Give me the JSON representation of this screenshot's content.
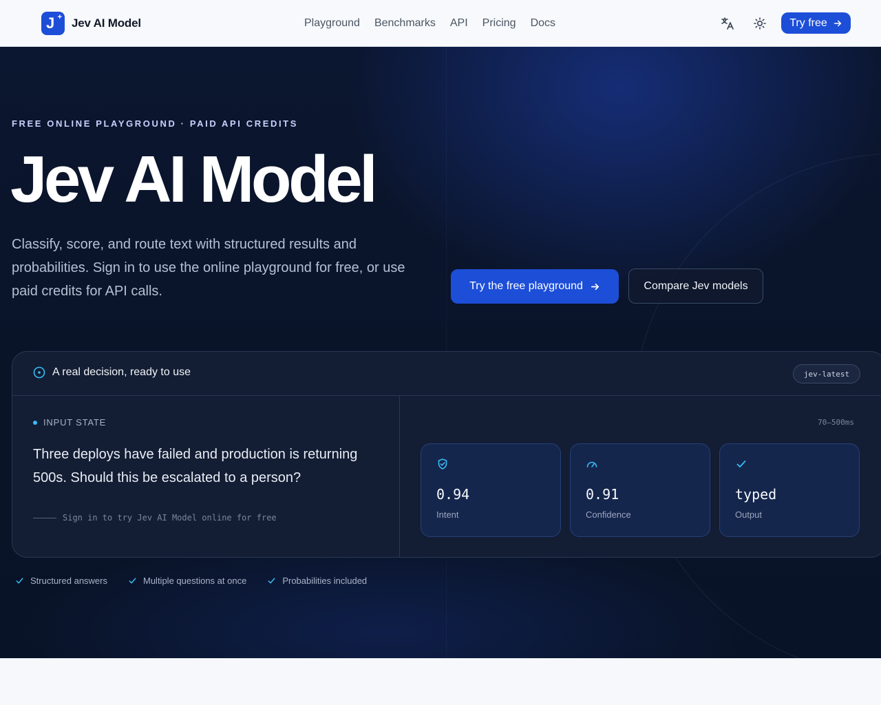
{
  "header": {
    "brand_name": "Jev AI Model",
    "logo_letter": "J",
    "nav": [
      "Playground",
      "Benchmarks",
      "API",
      "Pricing",
      "Docs"
    ],
    "icons": [
      "translate-icon",
      "sun-icon"
    ],
    "cta_label": "Try free"
  },
  "hero": {
    "eyebrow": "FREE ONLINE PLAYGROUND · PAID API CREDITS",
    "title": "Jev AI Model",
    "lede": "Classify, score, and route text with structured results and probabilities. Sign in to use the online playground for free, or use paid credits for API calls.",
    "primary_cta": "Try the free playground",
    "secondary_cta": "Compare Jev models"
  },
  "card": {
    "title": "A real decision, ready to use",
    "model_tag": "jev-latest",
    "input_label": "INPUT STATE",
    "question": "Three deploys have failed and production is returning 500s. Should this be escalated to a person?",
    "signin_hint": "Sign in to try Jev AI Model online for free",
    "latency": "70–500ms",
    "metrics": [
      {
        "icon": "shield-check-icon",
        "value": "0.94",
        "label": "Intent"
      },
      {
        "icon": "gauge-icon",
        "value": "0.91",
        "label": "Confidence"
      },
      {
        "icon": "check-icon",
        "value": "typed",
        "label": "Output"
      }
    ]
  },
  "features": [
    "Structured answers",
    "Multiple questions at once",
    "Probabilities included"
  ],
  "colors": {
    "accent": "#1d4ed8",
    "hero_bg": "#0a1428",
    "highlight": "#38bdf8"
  }
}
